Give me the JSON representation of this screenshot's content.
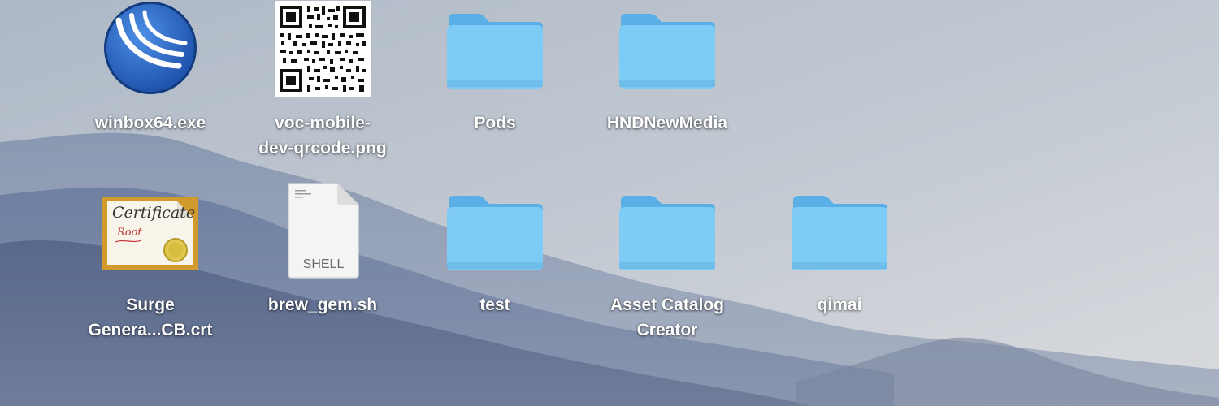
{
  "desktop": {
    "items": [
      {
        "label": "winbox64.exe",
        "icon": "winbox-app-icon"
      },
      {
        "label": "voc-mobile-\ndev-qrcode.png",
        "icon": "qr-code-image-icon"
      },
      {
        "label": "Pods",
        "icon": "folder-icon"
      },
      {
        "label": "HNDNewMedia",
        "icon": "folder-icon"
      },
      {
        "label": "Surge\nGenera...CB.crt",
        "icon": "certificate-icon",
        "certificate_text": [
          "Certificate",
          "Root"
        ]
      },
      {
        "label": "brew_gem.sh",
        "icon": "shell-script-icon",
        "file_type": "SHELL"
      },
      {
        "label": "test",
        "icon": "folder-icon"
      },
      {
        "label": "Asset Catalog\nCreator",
        "icon": "folder-icon"
      },
      {
        "label": "qimai",
        "icon": "folder-icon"
      }
    ]
  },
  "colors": {
    "folder_front": "#7ecbf5",
    "folder_back": "#5ab0e6",
    "sky": "#c9cfd6",
    "mountains": "#6f7f9c"
  }
}
